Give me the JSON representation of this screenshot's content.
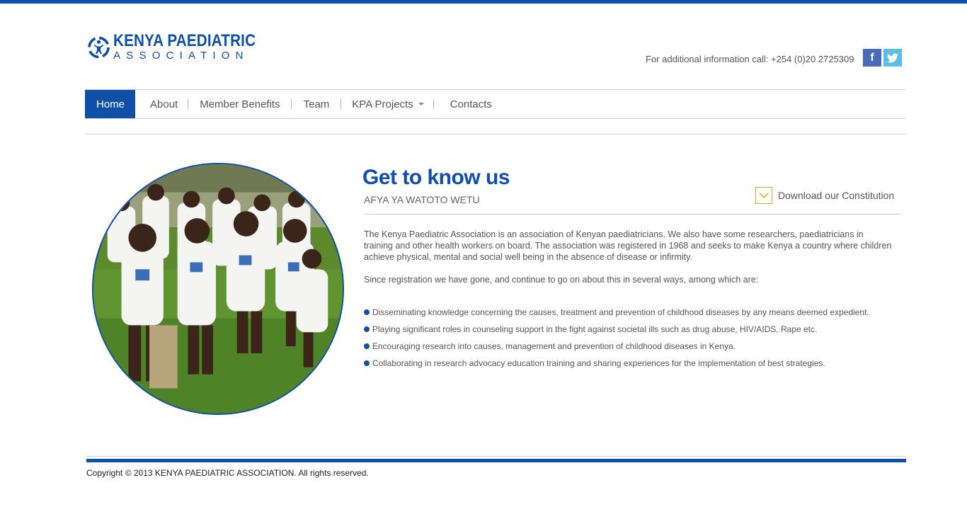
{
  "header": {
    "logo_title": "KENYA PAEDIATRIC",
    "logo_subtitle": "ASSOCIATION",
    "contact_text": "For additional information call: +254 (0)20 2725309",
    "social": [
      {
        "icon": "facebook-icon",
        "glyph": "f",
        "color": "#4a6cb6"
      },
      {
        "icon": "twitter-icon",
        "color": "#5bbde8"
      }
    ]
  },
  "nav": {
    "items": [
      {
        "label": "Home",
        "active": true
      },
      {
        "label": "About"
      },
      {
        "label": "Member Benefits"
      },
      {
        "label": "Team"
      },
      {
        "label": "KPA Projects",
        "dropdown": true
      },
      {
        "label": "Contacts"
      }
    ]
  },
  "main": {
    "heading": "Get to know us",
    "subheading": "AFYA YA WATOTO WETU",
    "download_label": "Download our Constitution",
    "paragraph1": "The Kenya Paediatric Association is an association of Kenyan paediatricians. We also have some researchers, paediatricians in training and other health workers on board. The association was registered in 1968 and seeks to make Kenya a country where children achieve physical, mental and social well being in the absence of disease or infirmity.",
    "paragraph2": "Since registration we have gone, and continue to go on about this in several ways, among which are:",
    "bullets": [
      "Disseminating knowledge concerning the causes, treatment and prevention of childhood diseases by any means deemed expedient.",
      "Playing significant roles in counseling support in the fight against societal ills such as drug abuse, HIV/AIDS, Rape etc.",
      "Encouraging research into causes, management and prevention of childhood diseases in Kenya.",
      "Collaborating in research advocacy education training and sharing experiences for the implementation of best strategies."
    ]
  },
  "footer": {
    "copyright": "Copyright © 2013 KENYA PAEDIATRIC ASSOCIATION. All rights reserved."
  },
  "colors": {
    "brand_blue": "#0f4fa8",
    "download_orange": "#f0a01e"
  }
}
